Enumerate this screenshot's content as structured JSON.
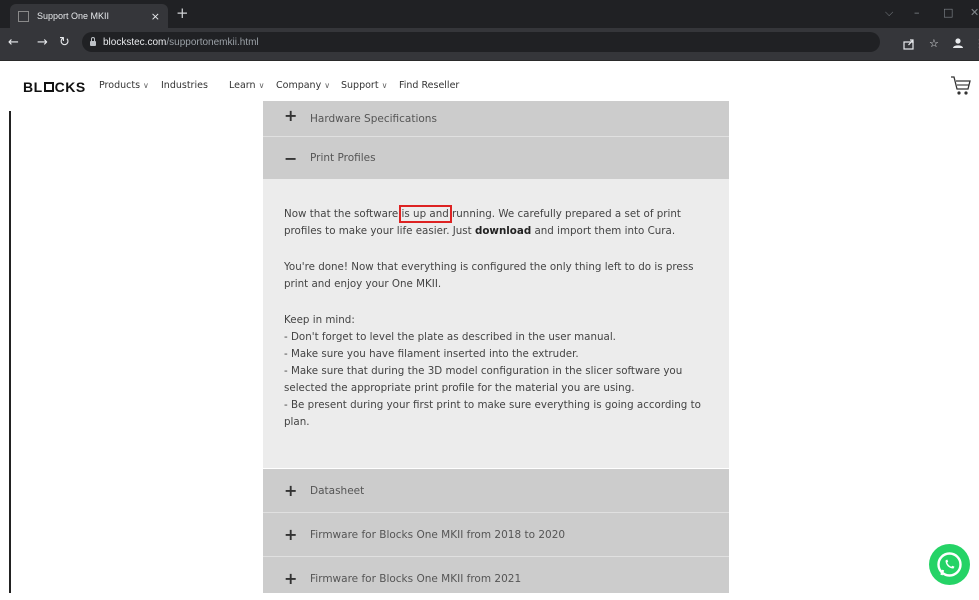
{
  "browser": {
    "tab_title": "Support One MKII",
    "tab_close": "×",
    "new_tab": "+",
    "url_host": "blockstec.com",
    "url_path": "/supportonemkii.html"
  },
  "header": {
    "logo_left": "BL",
    "logo_right": "CKS",
    "nav": [
      {
        "label": "Products",
        "chevron": "∨"
      },
      {
        "label": "Industries"
      },
      {
        "label": "Learn",
        "chevron": "∨"
      },
      {
        "label": "Company",
        "chevron": "∨"
      },
      {
        "label": "Support",
        "chevron": "∨"
      },
      {
        "label": "Find Reseller"
      }
    ]
  },
  "accordion": {
    "hardware": {
      "sign": "+",
      "label": "Hardware Specifications"
    },
    "print_profiles": {
      "sign": "−",
      "label": "Print Profiles"
    },
    "body": {
      "p1_a": "Now that the software ",
      "p1_hl": "is up and",
      "p1_b": " running. We carefully prepared a set of print profiles to make your life easier. Just ",
      "p1_bold": "download",
      "p1_c": " and import them into Cura.",
      "p2": "You're done! Now that everything is configured the only thing left to do is press print and enjoy your One MKII.",
      "p3_title": "Keep in mind:",
      "p3_items": [
        "- Don't forget to level the plate as described in the user manual.",
        "- Make sure you have filament inserted into the extruder.",
        "- Make sure that during the 3D model configuration in the slicer software you selected the appropriate print profile for the material you are using.",
        "- Be present during your first print to make sure everything is going according to plan."
      ]
    },
    "datasheet": {
      "sign": "+",
      "label": "Datasheet"
    },
    "fw_2018": {
      "sign": "+",
      "label": "Firmware for Blocks One MKII from 2018 to 2020"
    },
    "fw_2021": {
      "sign": "+",
      "label": "Firmware for Blocks One MKII from 2021"
    }
  },
  "colors": {
    "accent_highlight": "#dd2222",
    "whatsapp": "#25d366"
  },
  "icons": [
    "back-icon",
    "forward-icon",
    "reload-icon",
    "lock-icon",
    "share-icon",
    "star-icon",
    "profile-icon",
    "cart-icon",
    "whatsapp-icon"
  ]
}
